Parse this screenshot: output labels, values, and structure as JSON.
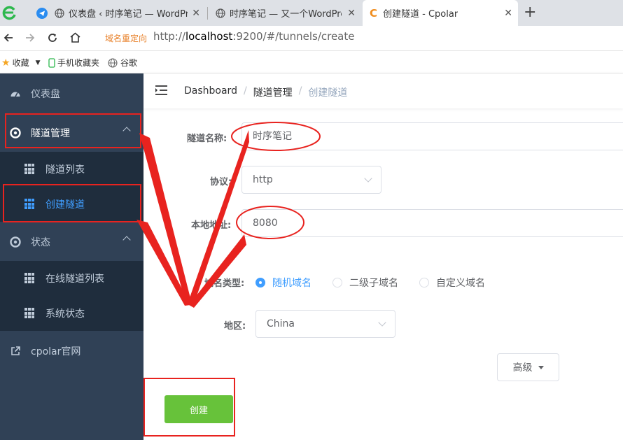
{
  "browser": {
    "tabs": [
      {
        "title": "仪表盘 ‹ 时序笔记 — WordPress",
        "active": false
      },
      {
        "title": "时序笔记 — 又一个WordPress站点",
        "active": false
      },
      {
        "title": "创建隧道 - Cpolar",
        "active": true
      }
    ],
    "tab_close": "✕",
    "new_tab": "+",
    "redirect_tag": "域名重定向",
    "url_scheme": "http://",
    "url_host": "localhost",
    "url_path": ":9200/#/tunnels/create",
    "bookmarks": [
      {
        "label": "收藏",
        "icon": "star-icon"
      },
      {
        "label": "手机收藏夹",
        "icon": "phone-icon"
      },
      {
        "label": "谷歌",
        "icon": "globe-icon"
      }
    ]
  },
  "sidebar": {
    "items": [
      {
        "label": "仪表盘",
        "icon": "dashboard-icon"
      },
      {
        "label": "隧道管理",
        "icon": "tunnel-icon"
      },
      {
        "label": "隧道列表",
        "icon": "grid-icon"
      },
      {
        "label": "创建隧道",
        "icon": "grid-icon"
      },
      {
        "label": "状态",
        "icon": "status-icon"
      },
      {
        "label": "在线隧道列表",
        "icon": "grid-icon"
      },
      {
        "label": "系统状态",
        "icon": "grid-icon"
      },
      {
        "label": "cpolar官网",
        "icon": "external-link-icon"
      }
    ]
  },
  "breadcrumb": {
    "items": [
      "Dashboard",
      "隧道管理",
      "创建隧道"
    ],
    "separator": "/"
  },
  "form": {
    "tunnel_name_label": "隧道名称:",
    "tunnel_name_value": "时序笔记",
    "protocol_label": "协议:",
    "protocol_value": "http",
    "local_address_label": "本地地址:",
    "local_address_value": "8080",
    "domain_type_label": "域名类型:",
    "domain_type_options": [
      "随机域名",
      "二级子域名",
      "自定义域名"
    ],
    "domain_type_selected": "随机域名",
    "region_label": "地区:",
    "region_value": "China",
    "advanced_label": "高级",
    "create_label": "创建"
  },
  "colors": {
    "sidebar_bg": "#304156",
    "submenu_bg": "#1f2d3d",
    "accent": "#409eff",
    "create_button": "#67c23a",
    "annotation": "#e8231f"
  }
}
